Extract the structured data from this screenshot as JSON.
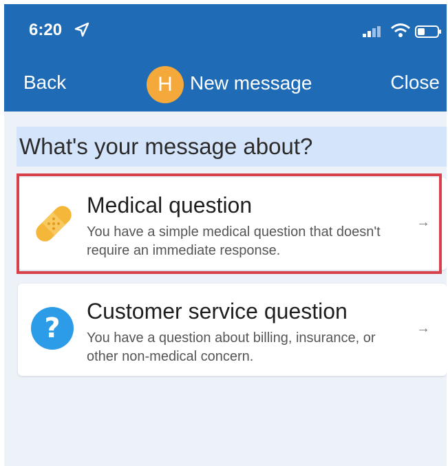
{
  "status_bar": {
    "time": "6:20"
  },
  "nav": {
    "back_label": "Back",
    "avatar_letter": "H",
    "title": "New message",
    "close_label": "Close"
  },
  "prompt": "What's your message about?",
  "options": [
    {
      "title": "Medical question",
      "description": "You have a simple medical question that doesn't require an immediate response.",
      "icon": "bandage-icon",
      "arrow": "→",
      "highlighted": true
    },
    {
      "title": "Customer service question",
      "description": "You have a question about billing, insurance, or other non-medical concern.",
      "icon": "question-circle-icon",
      "arrow": "→",
      "highlighted": false
    }
  ],
  "colors": {
    "header": "#1f6bb6",
    "avatar": "#f4a93a",
    "bandage": "#f4b73a",
    "question_icon": "#2c9be8",
    "highlight_border": "#d8414a",
    "prompt_bg": "#d4e4fb"
  }
}
